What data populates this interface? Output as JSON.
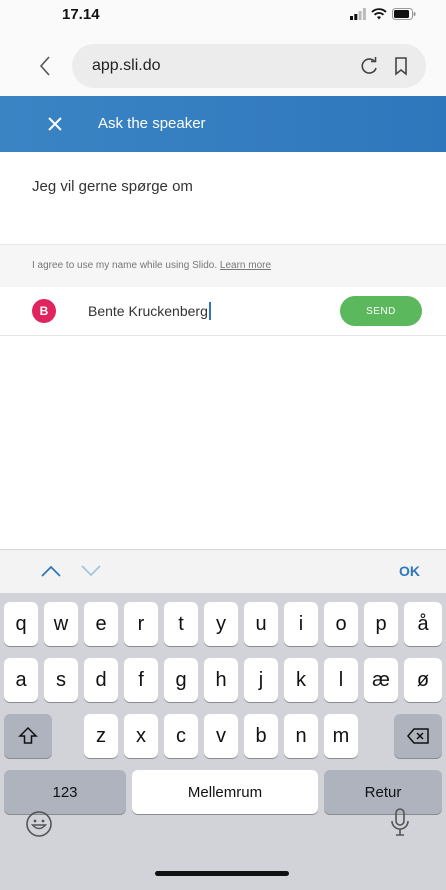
{
  "status": {
    "time": "17.14"
  },
  "browser": {
    "url": "app.sli.do"
  },
  "header": {
    "title": "Ask the speaker"
  },
  "question": {
    "value": "Jeg vil gerne spørge om"
  },
  "consent": {
    "text": "I agree to use my name while using Slido. ",
    "link": "Learn more"
  },
  "name_row": {
    "avatar_initial": "B",
    "name": "Bente Kruckenberg",
    "send_label": "SEND"
  },
  "keyboard": {
    "ok_label": "OK",
    "row1": [
      "q",
      "w",
      "e",
      "r",
      "t",
      "y",
      "u",
      "i",
      "o",
      "p",
      "å"
    ],
    "row2": [
      "a",
      "s",
      "d",
      "f",
      "g",
      "h",
      "j",
      "k",
      "l",
      "æ",
      "ø"
    ],
    "row3": [
      "z",
      "x",
      "c",
      "v",
      "b",
      "n",
      "m"
    ],
    "numbers_label": "123",
    "space_label": "Mellemrum",
    "return_label": "Retur"
  },
  "colors": {
    "accent": "#2f77bc",
    "send": "#5cb85c",
    "avatar": "#e0245e"
  }
}
